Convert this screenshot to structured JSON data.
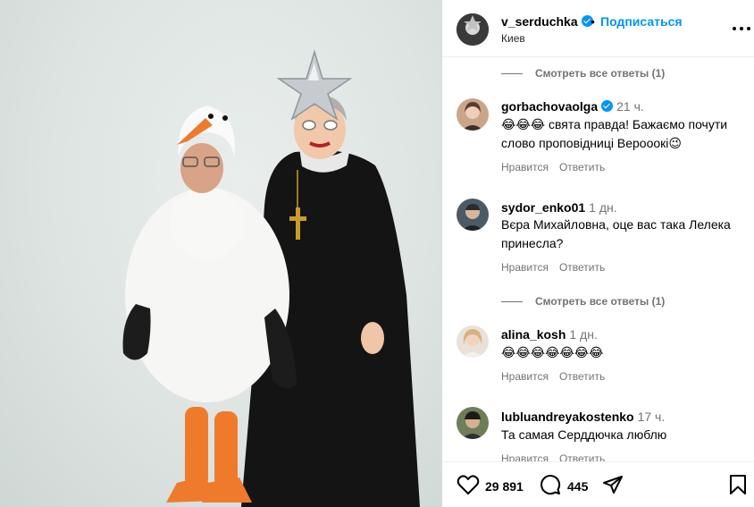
{
  "header": {
    "username": "v_serduchka",
    "separator": "•",
    "follow_label": "Подписаться",
    "location": "Киев"
  },
  "comments": {
    "view_replies_top": "Смотреть все ответы (1)",
    "items": [
      {
        "username": "gorbachovaolga",
        "verified": true,
        "time": "21 ч.",
        "text": "😂😂😂 свята правда! Бажаємо почути слово проповідниці Верооокі😉",
        "like_label": "Нравится",
        "reply_label": "Ответить"
      },
      {
        "username": "sydor_enko01",
        "verified": false,
        "time": "1 дн.",
        "text": "Вєра Михайловна, оце вас така Лелека принесла?",
        "like_label": "Нравится",
        "reply_label": "Ответить",
        "view_replies": "Смотреть все ответы (1)"
      },
      {
        "username": "alina_kosh",
        "verified": false,
        "time": "1 дн.",
        "text": "😂😂😂😂😂😂😂",
        "like_label": "Нравится",
        "reply_label": "Ответить"
      },
      {
        "username": "lubluandreyakostenko",
        "verified": false,
        "time": "17 ч.",
        "text": "Та самая Серддючка люблю",
        "like_label": "Нравится",
        "reply_label": "Ответить"
      }
    ]
  },
  "footer": {
    "likes": "29 891",
    "comments": "445"
  },
  "icons": {
    "like": "heart-icon",
    "comment": "comment-icon",
    "share": "send-icon",
    "save": "bookmark-icon",
    "more": "more-options-icon"
  },
  "colors": {
    "accent": "#0095f6",
    "muted": "#737373",
    "border": "#dbdbdb"
  }
}
